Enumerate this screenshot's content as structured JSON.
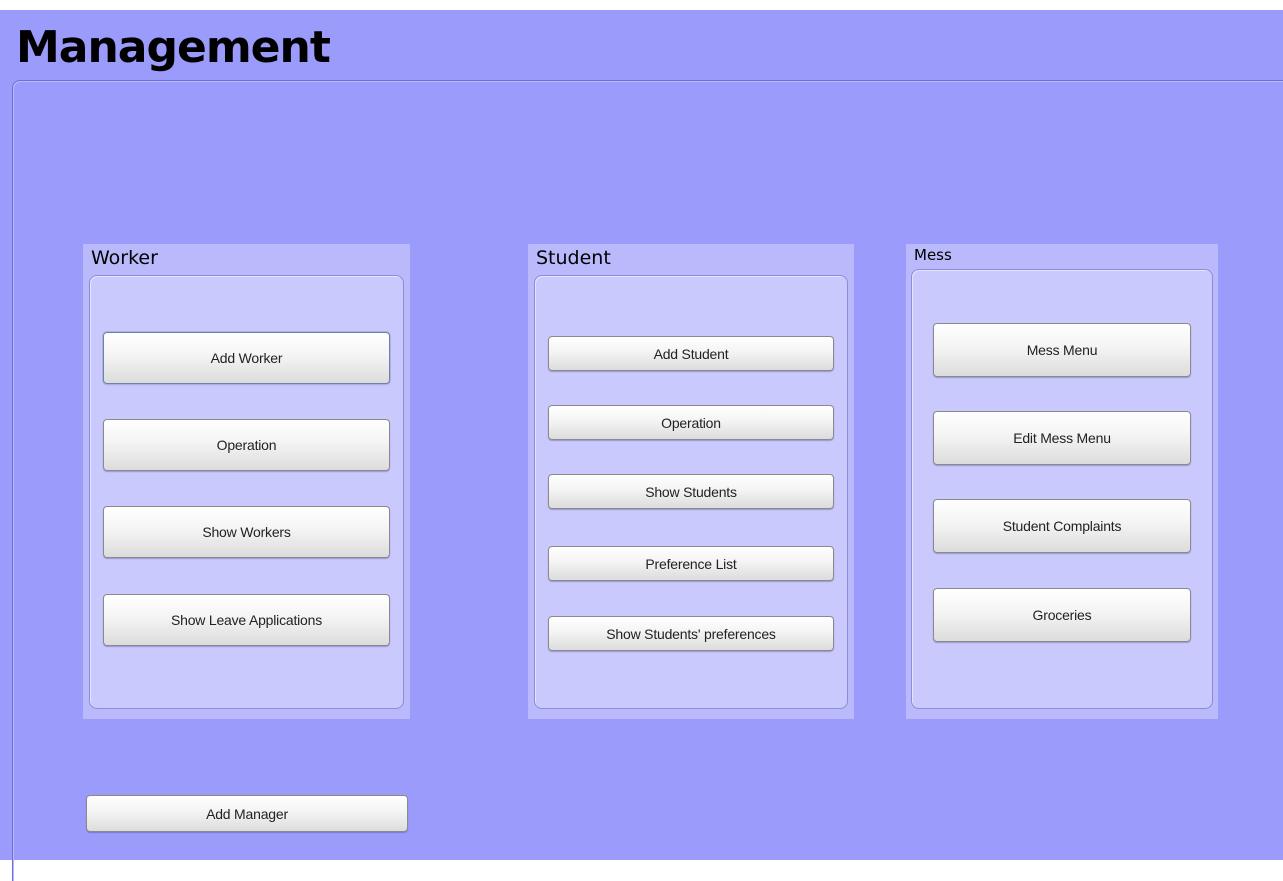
{
  "window": {
    "title": "Management"
  },
  "worker": {
    "title": "Worker",
    "buttons": {
      "add_worker": "Add Worker",
      "operation": "Operation",
      "show_workers": "Show Workers",
      "show_leave_applications": "Show Leave Applications"
    }
  },
  "student": {
    "title": "Student",
    "buttons": {
      "add_student": "Add Student",
      "operation": "Operation",
      "show_students": "Show Students",
      "preference_list": "Preference List",
      "show_students_preferences": "Show Students' preferences"
    }
  },
  "mess": {
    "title": "Mess",
    "buttons": {
      "mess_menu": "Mess Menu",
      "edit_mess_menu": "Edit Mess Menu",
      "student_complaints": "Student Complaints",
      "groceries": "Groceries"
    }
  },
  "footer": {
    "add_manager": "Add Manager"
  },
  "colors": {
    "background": "#9b9bfb",
    "panel": "#b9b9fb",
    "panel_inner": "#c9c9fd"
  }
}
